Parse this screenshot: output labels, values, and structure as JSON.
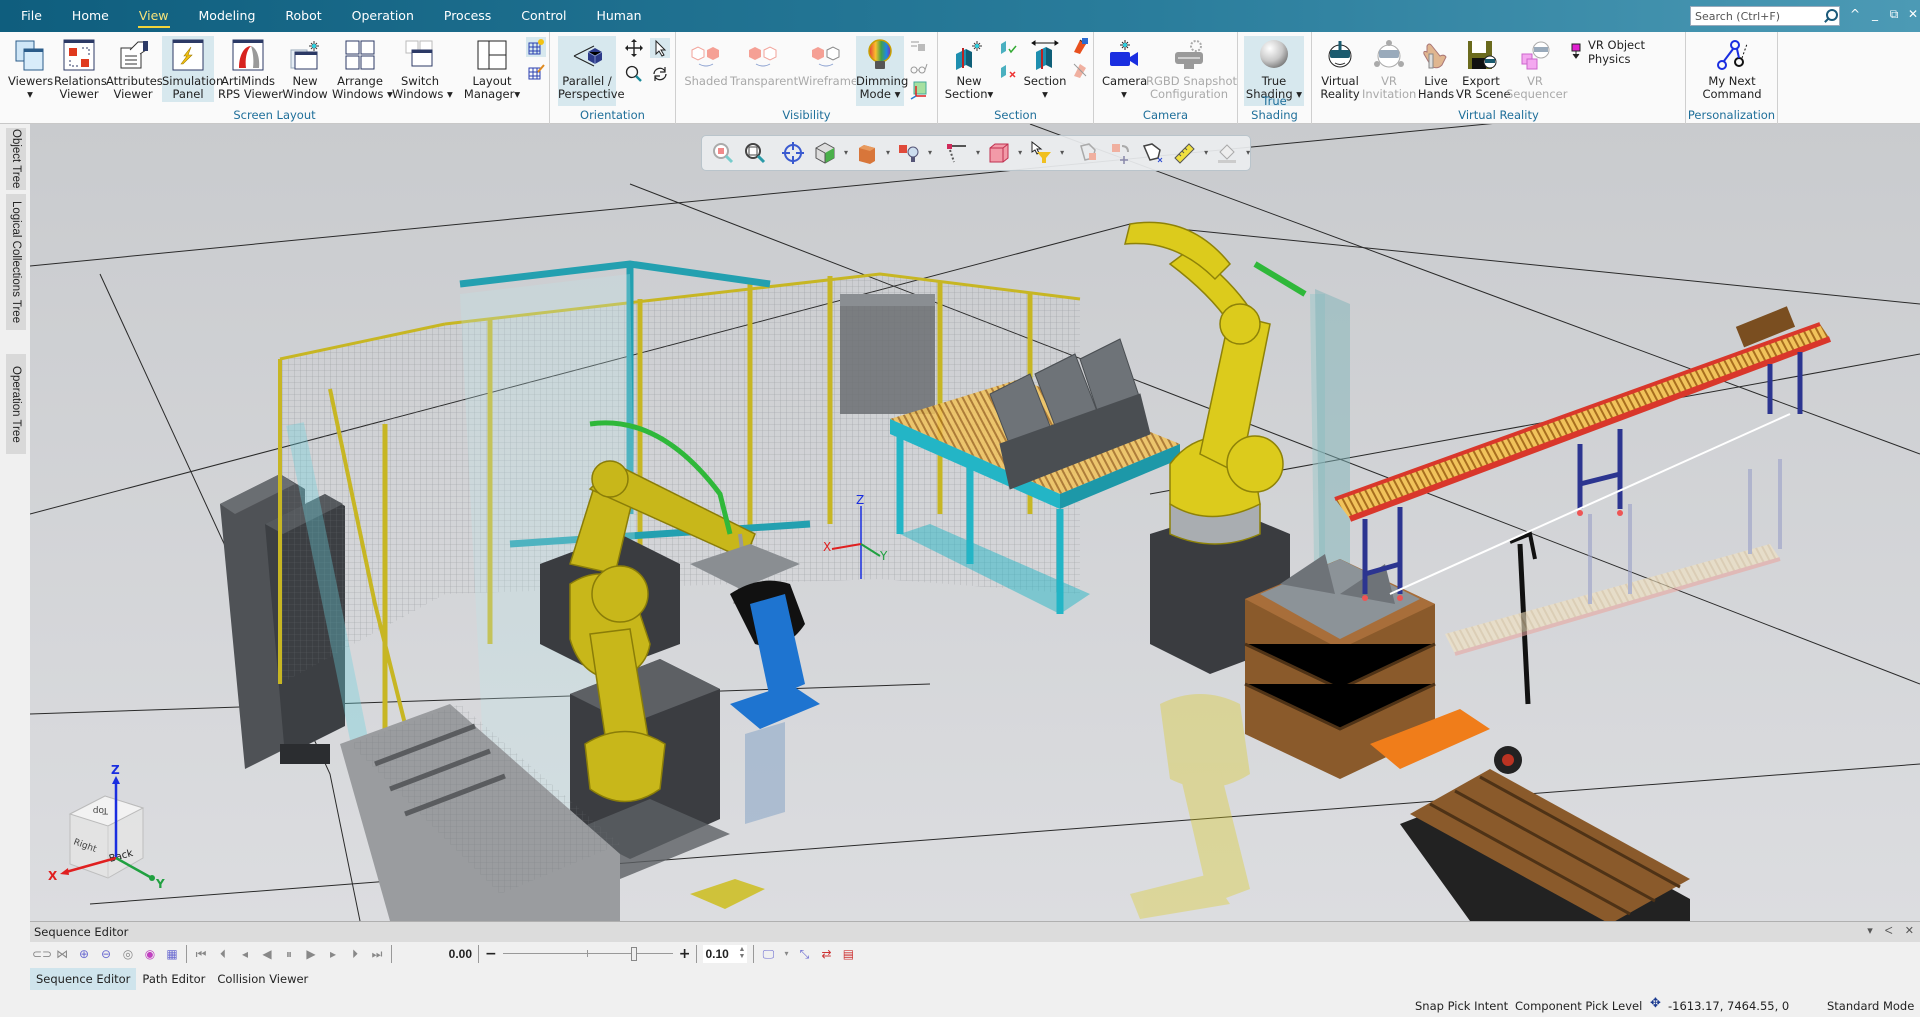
{
  "menu": {
    "items": [
      "File",
      "Home",
      "View",
      "Modeling",
      "Robot",
      "Operation",
      "Process",
      "Control",
      "Human"
    ],
    "active": "View"
  },
  "search": {
    "placeholder": "Search (Ctrl+F)"
  },
  "window_controls": {
    "collapse": "^",
    "minimize": "_",
    "restore": "⧉",
    "close": "✕"
  },
  "ribbon": {
    "groups": {
      "screen_layout": "Screen Layout",
      "orientation": "Orientation",
      "visibility": "Visibility",
      "section": "Section",
      "camera": "Camera",
      "true_shading": "True Shading",
      "virtual_reality": "Virtual Reality",
      "personalization": "Personalization"
    },
    "buttons": {
      "viewers": "Viewers",
      "viewers_dd": "▾",
      "relations_viewer_1": "Relations",
      "relations_viewer_2": "Viewer",
      "attributes_viewer_1": "Attributes",
      "attributes_viewer_2": "Viewer",
      "simulation_panel_1": "Simulation",
      "simulation_panel_2": "Panel",
      "artiminds_1": "ArtiMinds",
      "artiminds_2": "RPS Viewer",
      "new_window_1": "New",
      "new_window_2": "Window",
      "arrange_windows_1": "Arrange",
      "arrange_windows_2": "Windows ▾",
      "switch_windows_1": "Switch",
      "switch_windows_2": "Windows ▾",
      "layout_manager_1": "Layout",
      "layout_manager_2": "Manager▾",
      "parallel_1": "Parallel /",
      "parallel_2": "Perspective",
      "shaded": "Shaded",
      "transparent": "Transparent",
      "wireframe": "Wireframe",
      "dimming_1": "Dimming",
      "dimming_2": "Mode ▾",
      "new_section_1": "New",
      "new_section_2": "Section▾",
      "section": "Section",
      "section_dd": "▾",
      "camera": "Camera",
      "camera_dd": "▾",
      "rgbd_1": "RGBD Snapshot",
      "rgbd_2": "Configuration",
      "true_shading_1": "True",
      "true_shading_2": "Shading ▾",
      "virtual_reality_1": "Virtual",
      "virtual_reality_2": "Reality",
      "vr_invitation_1": "VR",
      "vr_invitation_2": "Invitation",
      "live_hands_1": "Live",
      "live_hands_2": "Hands",
      "export_vr_1": "Export",
      "export_vr_2": "VR Scene",
      "vr_sequencer_1": "VR",
      "vr_sequencer_2": "Sequencer",
      "vr_object_physics": "VR Object Physics",
      "my_next_1": "My Next",
      "my_next_2": "Command"
    }
  },
  "side_tabs": [
    "Object Tree",
    "Logical Collections Tree",
    "Operation Tree"
  ],
  "viewport": {
    "axis_labels": {
      "x": "X",
      "y": "Y",
      "z": "Z"
    },
    "nav_cube": {
      "top": "Top",
      "right": "Right",
      "back": "Back",
      "x": "X",
      "y": "Y",
      "z": "Z"
    },
    "colors": {
      "floor": "#d1d3d6",
      "robot_yellow": "#d8c817",
      "fence_yellow": "#c7b623",
      "frame_cyan": "#2ab3c4",
      "conveyor_red": "#d9372b",
      "conveyor_leg_blue": "#2c3590",
      "roller": "#e6b44d",
      "pallet_brown": "#8a5a2b",
      "positioner_blue": "#1e74d0",
      "jack_orange": "#f07d1a"
    }
  },
  "sequence_editor": {
    "title": "Sequence Editor",
    "time_value": "0.00",
    "speed_value": "0.10",
    "minus": "−",
    "plus": "+",
    "slider_fraction": 0.78,
    "tabs": [
      "Sequence Editor",
      "Path Editor",
      "Collision Viewer"
    ],
    "active_tab": "Sequence Editor",
    "panel_controls": {
      "menu": "▾",
      "pin": "ⵦ",
      "close": "✕"
    }
  },
  "status_bar": {
    "snap_pick": "Snap Pick Intent",
    "pick_level": "Component Pick Level",
    "coordinates": "-1613.17, 7464.55, 0",
    "mode": "Standard Mode"
  }
}
